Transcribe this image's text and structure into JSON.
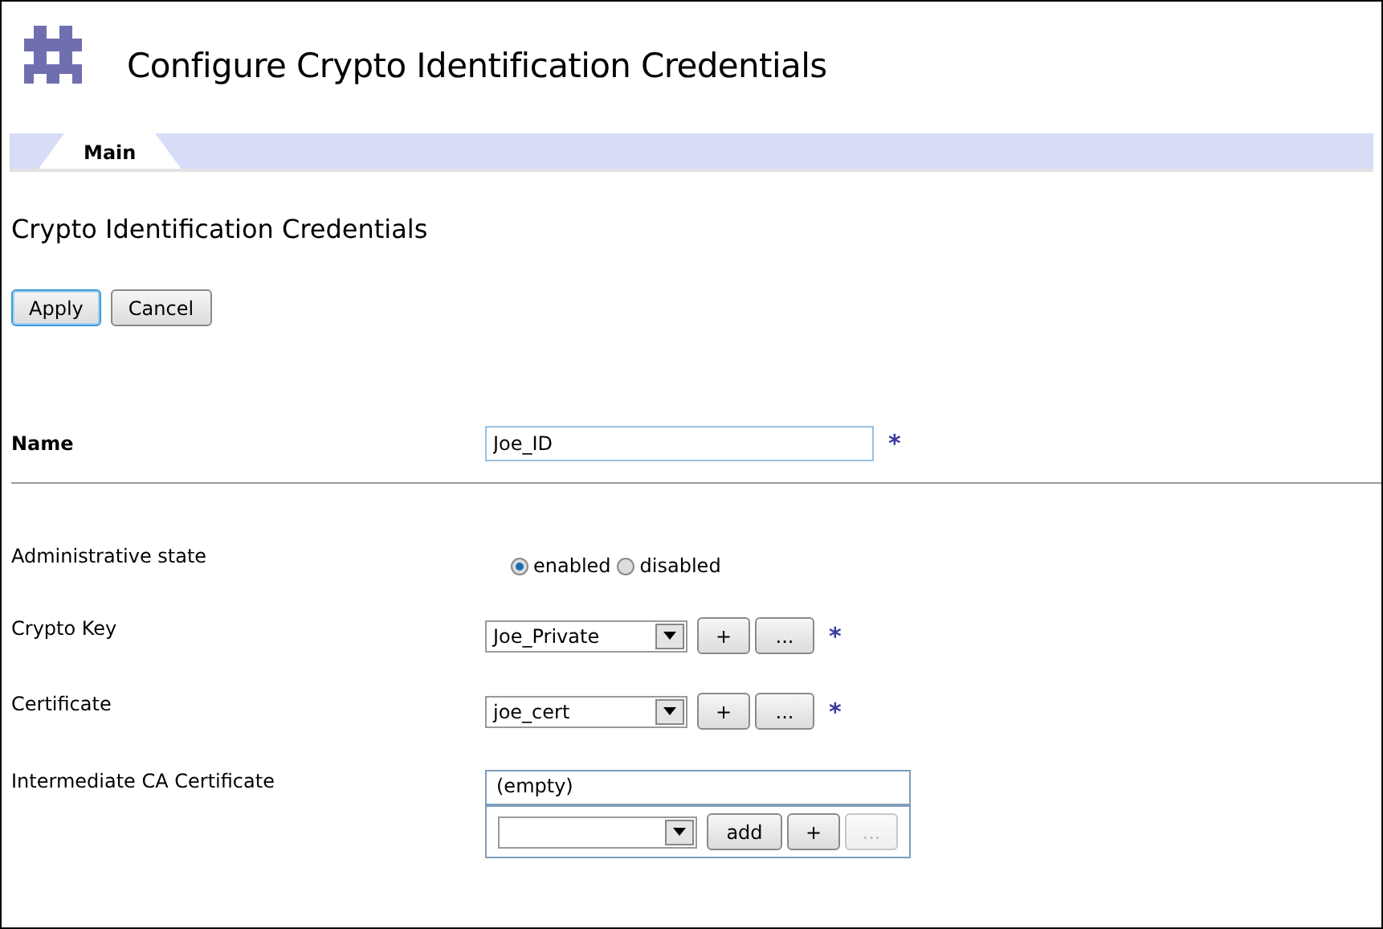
{
  "window": {
    "title": "Configure Crypto Identification Credentials"
  },
  "tabs": [
    {
      "label": "Main",
      "selected": true
    }
  ],
  "section_title": "Crypto Identification Credentials",
  "buttons": [
    {
      "label": "Apply",
      "focused": true
    },
    {
      "label": "Cancel",
      "focused": false
    }
  ],
  "fields": [
    {
      "kind": "text",
      "label": "Name",
      "bold": true,
      "value": "Joe_ID",
      "required_mark": "*"
    },
    {
      "kind": "radio",
      "label": "Administrative state",
      "bold": false,
      "options": [
        {
          "label": "enabled",
          "selected": true
        },
        {
          "label": "disabled",
          "selected": false
        }
      ]
    },
    {
      "kind": "select",
      "label": "Crypto Key",
      "bold": false,
      "value": "Joe_Private",
      "buttons": [
        {
          "label": "+",
          "disabled": false
        },
        {
          "label": "...",
          "disabled": false
        }
      ],
      "required_mark": "*"
    },
    {
      "kind": "select",
      "label": "Certificate",
      "bold": false,
      "value": "joe_cert",
      "buttons": [
        {
          "label": "+",
          "disabled": false
        },
        {
          "label": "...",
          "disabled": false
        }
      ],
      "required_mark": "*"
    },
    {
      "kind": "list",
      "label": "Intermediate CA Certificate",
      "bold": false,
      "items": [
        "(empty)"
      ],
      "buttons": [
        {
          "label": "add",
          "disabled": false
        },
        {
          "label": "+",
          "disabled": false
        },
        {
          "label": "...",
          "disabled": true
        }
      ]
    }
  ]
}
